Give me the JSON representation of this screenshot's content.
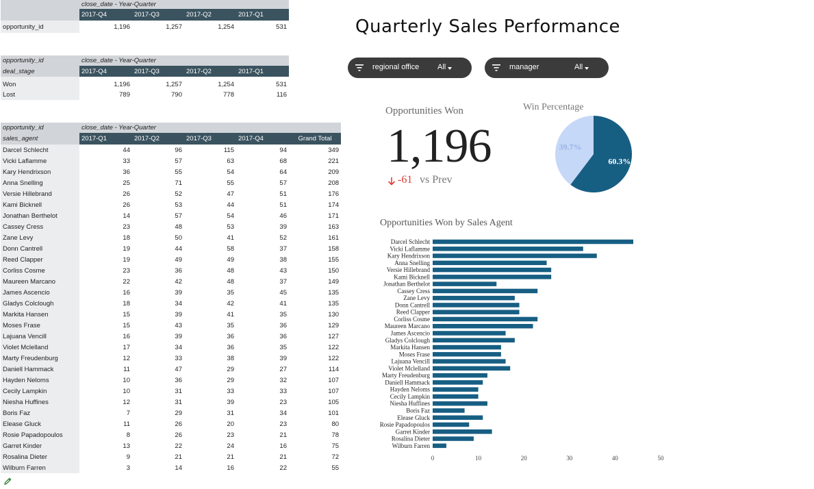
{
  "dashboard": {
    "title": "Quarterly Sales Performance"
  },
  "pivot_won": {
    "col_field": "close_date - Year-Quarter",
    "quarters": [
      "2017-Q4",
      "2017-Q3",
      "2017-Q2",
      "2017-Q1"
    ],
    "row_label": "opportunity_id",
    "values": [
      "1,196",
      "1,257",
      "1,254",
      "531"
    ]
  },
  "pivot_stage": {
    "metric_field": "opportunity_id",
    "row_field": "deal_stage",
    "col_field": "close_date - Year-Quarter",
    "quarters": [
      "2017-Q4",
      "2017-Q3",
      "2017-Q2",
      "2017-Q1"
    ],
    "rows": [
      {
        "label": "Won",
        "values": [
          "1,196",
          "1,257",
          "1,254",
          "531"
        ]
      },
      {
        "label": "Lost",
        "values": [
          "789",
          "790",
          "778",
          "116"
        ]
      }
    ]
  },
  "pivot_agents": {
    "metric_field": "opportunity_id",
    "row_field": "sales_agent",
    "col_field": "close_date - Year-Quarter",
    "columns": [
      "2017-Q1",
      "2017-Q2",
      "2017-Q3",
      "2017-Q4",
      "Grand Total"
    ],
    "rows": [
      [
        "Darcel Schlecht",
        "44",
        "96",
        "115",
        "94",
        "349"
      ],
      [
        "Vicki Laflamme",
        "33",
        "57",
        "63",
        "68",
        "221"
      ],
      [
        "Kary Hendrixson",
        "36",
        "55",
        "54",
        "64",
        "209"
      ],
      [
        "Anna Snelling",
        "25",
        "71",
        "55",
        "57",
        "208"
      ],
      [
        "Versie Hillebrand",
        "26",
        "52",
        "47",
        "51",
        "176"
      ],
      [
        "Kami Bicknell",
        "26",
        "53",
        "44",
        "51",
        "174"
      ],
      [
        "Jonathan Berthelot",
        "14",
        "57",
        "54",
        "46",
        "171"
      ],
      [
        "Cassey Cress",
        "23",
        "48",
        "53",
        "39",
        "163"
      ],
      [
        "Zane Levy",
        "18",
        "50",
        "41",
        "52",
        "161"
      ],
      [
        "Donn Cantrell",
        "19",
        "44",
        "58",
        "37",
        "158"
      ],
      [
        "Reed Clapper",
        "19",
        "49",
        "49",
        "38",
        "155"
      ],
      [
        "Corliss Cosme",
        "23",
        "36",
        "48",
        "43",
        "150"
      ],
      [
        "Maureen Marcano",
        "22",
        "42",
        "48",
        "37",
        "149"
      ],
      [
        "James Ascencio",
        "16",
        "39",
        "35",
        "45",
        "135"
      ],
      [
        "Gladys Colclough",
        "18",
        "34",
        "42",
        "41",
        "135"
      ],
      [
        "Markita Hansen",
        "15",
        "39",
        "41",
        "35",
        "130"
      ],
      [
        "Moses Frase",
        "15",
        "43",
        "35",
        "36",
        "129"
      ],
      [
        "Lajuana Vencill",
        "16",
        "39",
        "36",
        "36",
        "127"
      ],
      [
        "Violet Mclelland",
        "17",
        "34",
        "36",
        "35",
        "122"
      ],
      [
        "Marty Freudenburg",
        "12",
        "33",
        "38",
        "39",
        "122"
      ],
      [
        "Daniell Hammack",
        "11",
        "47",
        "29",
        "27",
        "114"
      ],
      [
        "Hayden Neloms",
        "10",
        "36",
        "29",
        "32",
        "107"
      ],
      [
        "Cecily Lampkin",
        "10",
        "31",
        "33",
        "33",
        "107"
      ],
      [
        "Niesha Huffines",
        "12",
        "31",
        "39",
        "23",
        "105"
      ],
      [
        "Boris Faz",
        "7",
        "29",
        "31",
        "34",
        "101"
      ],
      [
        "Elease Gluck",
        "11",
        "26",
        "20",
        "23",
        "80"
      ],
      [
        "Rosie Papadopoulos",
        "8",
        "26",
        "23",
        "21",
        "78"
      ],
      [
        "Garret Kinder",
        "13",
        "22",
        "24",
        "16",
        "75"
      ],
      [
        "Rosalina Dieter",
        "9",
        "21",
        "21",
        "21",
        "72"
      ],
      [
        "Wilburn Farren",
        "3",
        "14",
        "16",
        "22",
        "55"
      ]
    ]
  },
  "filters": [
    {
      "label": "regional office",
      "value": "All"
    },
    {
      "label": "manager",
      "value": "All"
    }
  ],
  "icons": {
    "filter": "filter-icon",
    "dropdown": "chevron-down-icon",
    "delta": "arrow-down-icon",
    "edit": "pencil-icon"
  },
  "scorecard": {
    "title": "Opportunities Won",
    "value": "1,196",
    "delta": "-61",
    "comparison": "vs Prev",
    "delta_color": "#e53935"
  },
  "chart_data": [
    {
      "type": "pie",
      "title": "Win Percentage",
      "labels": [
        "60.3%",
        "39.7%"
      ],
      "values": [
        60.3,
        39.7
      ],
      "colors": [
        "#175e83",
        "#c6d8f7"
      ]
    },
    {
      "type": "bar",
      "orientation": "horizontal",
      "title": "Opportunities Won by Sales Agent",
      "categories": [
        "Darcel Schlecht",
        "Vicki Laflamme",
        "Kary Hendrixson",
        "Anna Snelling",
        "Versie Hillebrand",
        "Kami Bicknell",
        "Jonathan Berthelot",
        "Cassey Cress",
        "Zane Levy",
        "Donn Cantrell",
        "Reed Clapper",
        "Corliss Cosme",
        "Maureen Marcano",
        "James Ascencio",
        "Gladys Colclough",
        "Markita Hansen",
        "Moses Frase",
        "Lajuana Vencill",
        "Violet Mclelland",
        "Marty Freudenburg",
        "Daniell Hammack",
        "Hayden Neloms",
        "Cecily Lampkin",
        "Niesha Huffines",
        "Boris Faz",
        "Elease Gluck",
        "Rosie Papadopoulos",
        "Garret Kinder",
        "Rosalina Dieter",
        "Wilburn Farren"
      ],
      "values": [
        44,
        33,
        36,
        25,
        26,
        26,
        14,
        23,
        18,
        19,
        19,
        23,
        22,
        16,
        18,
        15,
        15,
        16,
        17,
        12,
        11,
        10,
        10,
        12,
        7,
        11,
        8,
        13,
        9,
        3
      ],
      "xlim": [
        0,
        50
      ],
      "xticks": [
        "0",
        "10",
        "20",
        "30",
        "40",
        "50"
      ],
      "bar_color": "#175e83",
      "grid": false
    }
  ]
}
